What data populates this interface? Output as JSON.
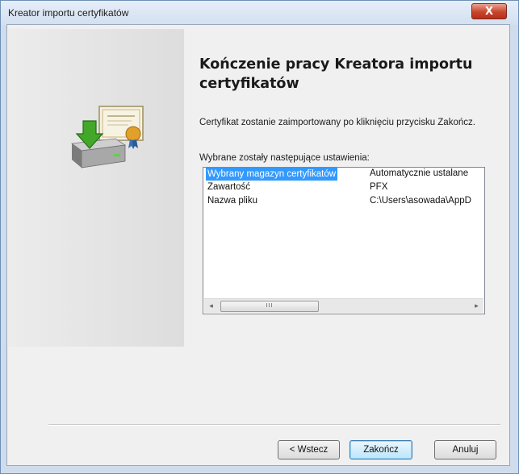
{
  "window": {
    "title": "Kreator importu certyfikatów",
    "close_glyph": "X"
  },
  "wizard": {
    "heading": "Kończenie pracy Kreatora importu certyfikatów",
    "description": "Certyfikat zostanie zaimportowany po kliknięciu przycisku Zakończ.",
    "settings_label": "Wybrane zostały następujące ustawienia:",
    "icon": "certificate-import-icon"
  },
  "settings": {
    "rows": [
      {
        "name": "Wybrany magazyn certyfikatów",
        "value": "Automatycznie ustalane",
        "selected": true
      },
      {
        "name": "Zawartość",
        "value": "PFX",
        "selected": false
      },
      {
        "name": "Nazwa pliku",
        "value": "C:\\Users\\asowada\\AppD",
        "selected": false
      }
    ],
    "scrollbar": {
      "left_arrow": "◂",
      "right_arrow": "▸",
      "thumb_grip": "III"
    }
  },
  "buttons": {
    "back": "< Wstecz",
    "finish": "Zakończ",
    "cancel": "Anuluj"
  },
  "colors": {
    "selection": "#3399ff",
    "close_button": "#c8452c"
  }
}
